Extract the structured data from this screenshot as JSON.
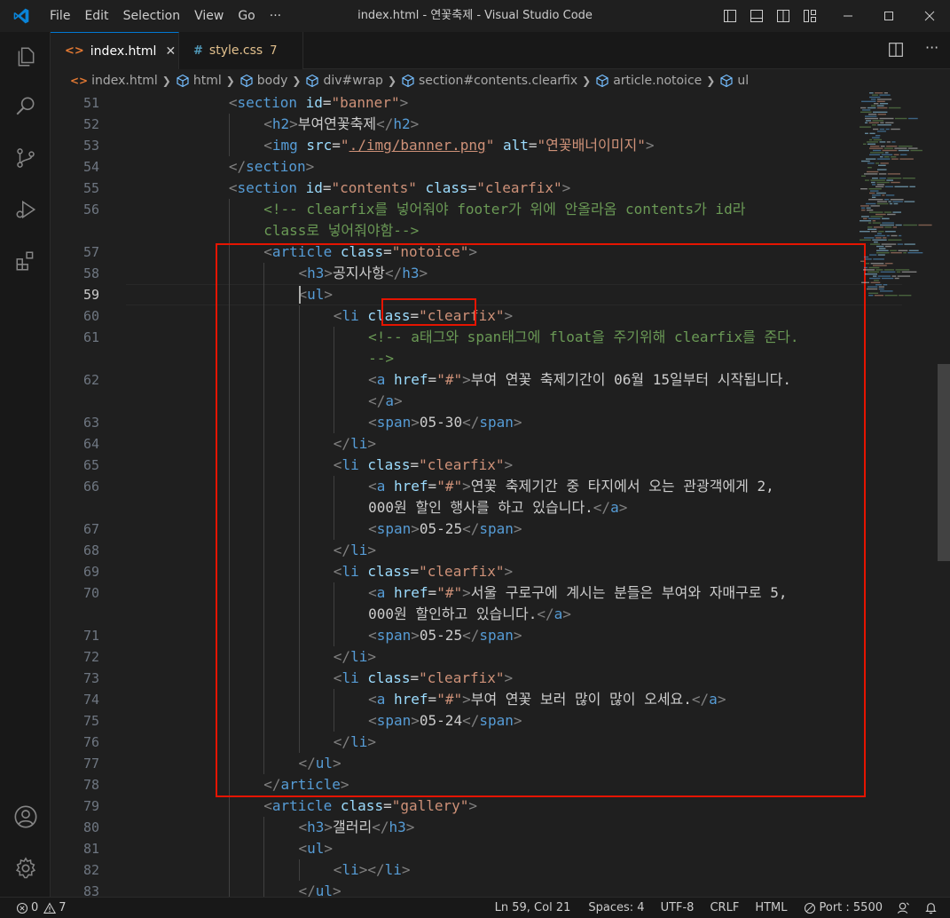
{
  "window": {
    "title": "index.html - 연꽃축제 - Visual Studio Code",
    "menu": [
      "File",
      "Edit",
      "Selection",
      "View",
      "Go",
      "···"
    ]
  },
  "tabs": [
    {
      "label": "index.html",
      "icon": "<>",
      "active": true
    },
    {
      "label": "style.css",
      "icon": "#",
      "badge": "7",
      "active": false
    }
  ],
  "breadcrumb": [
    "index.html",
    "html",
    "body",
    "div#wrap",
    "section#contents.clearfix",
    "article.notoice",
    "ul"
  ],
  "editor": {
    "lines": [
      {
        "n": "51",
        "indent": 3,
        "tokens": [
          [
            "br",
            "<"
          ],
          [
            "tag",
            "section"
          ],
          [
            "txt",
            " "
          ],
          [
            "attr",
            "id"
          ],
          [
            "txt",
            "="
          ],
          [
            "str",
            "\"banner\""
          ],
          [
            "br",
            ">"
          ]
        ]
      },
      {
        "n": "52",
        "indent": 4,
        "tokens": [
          [
            "br",
            "<"
          ],
          [
            "tag",
            "h2"
          ],
          [
            "br",
            ">"
          ],
          [
            "txt",
            "부여연꽃축제"
          ],
          [
            "br",
            "</"
          ],
          [
            "tag",
            "h2"
          ],
          [
            "br",
            ">"
          ]
        ]
      },
      {
        "n": "53",
        "indent": 4,
        "tokens": [
          [
            "br",
            "<"
          ],
          [
            "tag",
            "img"
          ],
          [
            "txt",
            " "
          ],
          [
            "attr",
            "src"
          ],
          [
            "txt",
            "="
          ],
          [
            "str",
            "\""
          ],
          [
            "link",
            "./img/banner.png"
          ],
          [
            "str",
            "\""
          ],
          [
            "txt",
            " "
          ],
          [
            "attr",
            "alt"
          ],
          [
            "txt",
            "="
          ],
          [
            "str",
            "\"연꽃배너이미지\""
          ],
          [
            "br",
            ">"
          ]
        ]
      },
      {
        "n": "54",
        "indent": 3,
        "tokens": [
          [
            "br",
            "</"
          ],
          [
            "tag",
            "section"
          ],
          [
            "br",
            ">"
          ]
        ]
      },
      {
        "n": "55",
        "indent": 3,
        "tokens": [
          [
            "br",
            "<"
          ],
          [
            "tag",
            "section"
          ],
          [
            "txt",
            " "
          ],
          [
            "attr",
            "id"
          ],
          [
            "txt",
            "="
          ],
          [
            "str",
            "\"contents\""
          ],
          [
            "txt",
            " "
          ],
          [
            "attr",
            "class"
          ],
          [
            "txt",
            "="
          ],
          [
            "str",
            "\"clearfix\""
          ],
          [
            "br",
            ">"
          ]
        ]
      },
      {
        "n": "56",
        "indent": 4,
        "tokens": [
          [
            "com",
            "<!-- clearfix를 넣어줘야 footer가 위에 안올라옴 contents가 id라"
          ]
        ]
      },
      {
        "n": "",
        "indent": 4,
        "tokens": [
          [
            "com",
            "class로 넣어줘야함-->"
          ]
        ]
      },
      {
        "n": "57",
        "indent": 4,
        "tokens": [
          [
            "br",
            "<"
          ],
          [
            "tag",
            "article"
          ],
          [
            "txt",
            " "
          ],
          [
            "attr",
            "class"
          ],
          [
            "txt",
            "="
          ],
          [
            "str",
            "\"notoice\""
          ],
          [
            "br",
            ">"
          ]
        ]
      },
      {
        "n": "58",
        "indent": 5,
        "tokens": [
          [
            "br",
            "<"
          ],
          [
            "tag",
            "h3"
          ],
          [
            "br",
            ">"
          ],
          [
            "txt",
            "공지사항"
          ],
          [
            "br",
            "</"
          ],
          [
            "tag",
            "h3"
          ],
          [
            "br",
            ">"
          ]
        ]
      },
      {
        "n": "59",
        "indent": 5,
        "tokens": [
          [
            "br",
            "<"
          ],
          [
            "tag",
            "ul"
          ],
          [
            "br",
            ">"
          ]
        ]
      },
      {
        "n": "60",
        "indent": 6,
        "tokens": [
          [
            "br",
            "<"
          ],
          [
            "tag",
            "li"
          ],
          [
            "txt",
            " "
          ],
          [
            "attr",
            "class"
          ],
          [
            "txt",
            "="
          ],
          [
            "str",
            "\"clearfix\""
          ],
          [
            "br",
            ">"
          ]
        ]
      },
      {
        "n": "61",
        "indent": 7,
        "tokens": [
          [
            "com",
            "<!-- a태그와 span태그에 float을 주기위해 clearfix를 준다."
          ]
        ]
      },
      {
        "n": "",
        "indent": 7,
        "tokens": [
          [
            "com",
            "-->"
          ]
        ]
      },
      {
        "n": "62",
        "indent": 7,
        "tokens": [
          [
            "br",
            "<"
          ],
          [
            "tag",
            "a"
          ],
          [
            "txt",
            " "
          ],
          [
            "attr",
            "href"
          ],
          [
            "txt",
            "="
          ],
          [
            "str",
            "\"#\""
          ],
          [
            "br",
            ">"
          ],
          [
            "txt",
            "부여 연꽃 축제기간이 06월 15일부터 시작됩니다."
          ]
        ]
      },
      {
        "n": "",
        "indent": 7,
        "tokens": [
          [
            "br",
            "</"
          ],
          [
            "tag",
            "a"
          ],
          [
            "br",
            ">"
          ]
        ]
      },
      {
        "n": "63",
        "indent": 7,
        "tokens": [
          [
            "br",
            "<"
          ],
          [
            "tag",
            "span"
          ],
          [
            "br",
            ">"
          ],
          [
            "txt",
            "05-30"
          ],
          [
            "br",
            "</"
          ],
          [
            "tag",
            "span"
          ],
          [
            "br",
            ">"
          ]
        ]
      },
      {
        "n": "64",
        "indent": 6,
        "tokens": [
          [
            "br",
            "</"
          ],
          [
            "tag",
            "li"
          ],
          [
            "br",
            ">"
          ]
        ]
      },
      {
        "n": "65",
        "indent": 6,
        "tokens": [
          [
            "br",
            "<"
          ],
          [
            "tag",
            "li"
          ],
          [
            "txt",
            " "
          ],
          [
            "attr",
            "class"
          ],
          [
            "txt",
            "="
          ],
          [
            "str",
            "\"clearfix\""
          ],
          [
            "br",
            ">"
          ]
        ]
      },
      {
        "n": "66",
        "indent": 7,
        "tokens": [
          [
            "br",
            "<"
          ],
          [
            "tag",
            "a"
          ],
          [
            "txt",
            " "
          ],
          [
            "attr",
            "href"
          ],
          [
            "txt",
            "="
          ],
          [
            "str",
            "\"#\""
          ],
          [
            "br",
            ">"
          ],
          [
            "txt",
            "연꽃 축제기간 중 타지에서 오는 관광객에게 2,"
          ]
        ]
      },
      {
        "n": "",
        "indent": 7,
        "tokens": [
          [
            "txt",
            "000원 할인 행사를 하고 있습니다."
          ],
          [
            "br",
            "</"
          ],
          [
            "tag",
            "a"
          ],
          [
            "br",
            ">"
          ]
        ]
      },
      {
        "n": "67",
        "indent": 7,
        "tokens": [
          [
            "br",
            "<"
          ],
          [
            "tag",
            "span"
          ],
          [
            "br",
            ">"
          ],
          [
            "txt",
            "05-25"
          ],
          [
            "br",
            "</"
          ],
          [
            "tag",
            "span"
          ],
          [
            "br",
            ">"
          ]
        ]
      },
      {
        "n": "68",
        "indent": 6,
        "tokens": [
          [
            "br",
            "</"
          ],
          [
            "tag",
            "li"
          ],
          [
            "br",
            ">"
          ]
        ]
      },
      {
        "n": "69",
        "indent": 6,
        "tokens": [
          [
            "br",
            "<"
          ],
          [
            "tag",
            "li"
          ],
          [
            "txt",
            " "
          ],
          [
            "attr",
            "class"
          ],
          [
            "txt",
            "="
          ],
          [
            "str",
            "\"clearfix\""
          ],
          [
            "br",
            ">"
          ]
        ]
      },
      {
        "n": "70",
        "indent": 7,
        "tokens": [
          [
            "br",
            "<"
          ],
          [
            "tag",
            "a"
          ],
          [
            "txt",
            " "
          ],
          [
            "attr",
            "href"
          ],
          [
            "txt",
            "="
          ],
          [
            "str",
            "\"#\""
          ],
          [
            "br",
            ">"
          ],
          [
            "txt",
            "서울 구로구에 계시는 분들은 부여와 자매구로 5,"
          ]
        ]
      },
      {
        "n": "",
        "indent": 7,
        "tokens": [
          [
            "txt",
            "000원 할인하고 있습니다."
          ],
          [
            "br",
            "</"
          ],
          [
            "tag",
            "a"
          ],
          [
            "br",
            ">"
          ]
        ]
      },
      {
        "n": "71",
        "indent": 7,
        "tokens": [
          [
            "br",
            "<"
          ],
          [
            "tag",
            "span"
          ],
          [
            "br",
            ">"
          ],
          [
            "txt",
            "05-25"
          ],
          [
            "br",
            "</"
          ],
          [
            "tag",
            "span"
          ],
          [
            "br",
            ">"
          ]
        ]
      },
      {
        "n": "72",
        "indent": 6,
        "tokens": [
          [
            "br",
            "</"
          ],
          [
            "tag",
            "li"
          ],
          [
            "br",
            ">"
          ]
        ]
      },
      {
        "n": "73",
        "indent": 6,
        "tokens": [
          [
            "br",
            "<"
          ],
          [
            "tag",
            "li"
          ],
          [
            "txt",
            " "
          ],
          [
            "attr",
            "class"
          ],
          [
            "txt",
            "="
          ],
          [
            "str",
            "\"clearfix\""
          ],
          [
            "br",
            ">"
          ]
        ]
      },
      {
        "n": "74",
        "indent": 7,
        "tokens": [
          [
            "br",
            "<"
          ],
          [
            "tag",
            "a"
          ],
          [
            "txt",
            " "
          ],
          [
            "attr",
            "href"
          ],
          [
            "txt",
            "="
          ],
          [
            "str",
            "\"#\""
          ],
          [
            "br",
            ">"
          ],
          [
            "txt",
            "부여 연꽃 보러 많이 많이 오세요."
          ],
          [
            "br",
            "</"
          ],
          [
            "tag",
            "a"
          ],
          [
            "br",
            ">"
          ]
        ]
      },
      {
        "n": "75",
        "indent": 7,
        "tokens": [
          [
            "br",
            "<"
          ],
          [
            "tag",
            "span"
          ],
          [
            "br",
            ">"
          ],
          [
            "txt",
            "05-24"
          ],
          [
            "br",
            "</"
          ],
          [
            "tag",
            "span"
          ],
          [
            "br",
            ">"
          ]
        ]
      },
      {
        "n": "76",
        "indent": 6,
        "tokens": [
          [
            "br",
            "</"
          ],
          [
            "tag",
            "li"
          ],
          [
            "br",
            ">"
          ]
        ]
      },
      {
        "n": "77",
        "indent": 5,
        "tokens": [
          [
            "br",
            "</"
          ],
          [
            "tag",
            "ul"
          ],
          [
            "br",
            ">"
          ]
        ]
      },
      {
        "n": "78",
        "indent": 4,
        "tokens": [
          [
            "br",
            "</"
          ],
          [
            "tag",
            "article"
          ],
          [
            "br",
            ">"
          ]
        ]
      },
      {
        "n": "79",
        "indent": 4,
        "tokens": [
          [
            "br",
            "<"
          ],
          [
            "tag",
            "article"
          ],
          [
            "txt",
            " "
          ],
          [
            "attr",
            "class"
          ],
          [
            "txt",
            "="
          ],
          [
            "str",
            "\"gallery\""
          ],
          [
            "br",
            ">"
          ]
        ]
      },
      {
        "n": "80",
        "indent": 5,
        "tokens": [
          [
            "br",
            "<"
          ],
          [
            "tag",
            "h3"
          ],
          [
            "br",
            ">"
          ],
          [
            "txt",
            "갤러리"
          ],
          [
            "br",
            "</"
          ],
          [
            "tag",
            "h3"
          ],
          [
            "br",
            ">"
          ]
        ]
      },
      {
        "n": "81",
        "indent": 5,
        "tokens": [
          [
            "br",
            "<"
          ],
          [
            "tag",
            "ul"
          ],
          [
            "br",
            ">"
          ]
        ]
      },
      {
        "n": "82",
        "indent": 6,
        "tokens": [
          [
            "br",
            "<"
          ],
          [
            "tag",
            "li"
          ],
          [
            "br",
            "></"
          ],
          [
            "tag",
            "li"
          ],
          [
            "br",
            ">"
          ]
        ]
      },
      {
        "n": "83",
        "indent": 5,
        "tokens": [
          [
            "br",
            "</"
          ],
          [
            "tag",
            "ul"
          ],
          [
            "br",
            ">"
          ]
        ]
      }
    ],
    "current_line": "59"
  },
  "statusbar": {
    "errors": "0",
    "warnings": "7",
    "position": "Ln 59, Col 21",
    "spaces": "Spaces: 4",
    "encoding": "UTF-8",
    "eol": "CRLF",
    "language": "HTML",
    "port": "Port : 5500"
  },
  "colors": {
    "accent": "#0078d4",
    "highlight": "#e51400",
    "tag": "#569cd6",
    "attr": "#9cdcfe",
    "string": "#ce9178",
    "comment": "#6a9955"
  }
}
